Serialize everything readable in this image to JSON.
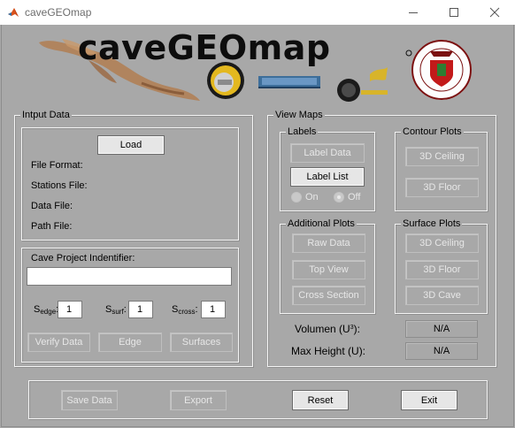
{
  "window": {
    "title": "caveGEOmap",
    "icon": "matlab-icon",
    "controls": [
      "minimize-icon",
      "maximize-icon",
      "close-icon"
    ]
  },
  "banner": {
    "title": "caveGEOmap",
    "logos": [
      "cave-survey-illustration",
      "round-badge-logo",
      "ucon-logo",
      "satellite-emblem-logo",
      "university-crest-seal"
    ]
  },
  "input_panel": {
    "title": "Intput Data",
    "load_label": "Load",
    "info": {
      "file_format": "File Format:",
      "stations_file": "Stations File:",
      "data_file": "Data File:",
      "path_file": "Path File:"
    },
    "project": {
      "label": "Cave Project Indentifier:",
      "value": "",
      "edge_label": "S",
      "edge_sub": "edge",
      "edge_value": "1",
      "surf_label": "S",
      "surf_sub": "surf",
      "surf_value": "1",
      "cross_label": "S",
      "cross_sub": "cross",
      "cross_value": "1",
      "verify_label": "Verify Data",
      "edge_btn_label": "Edge",
      "surfaces_label": "Surfaces"
    }
  },
  "view_panel": {
    "title": "View Maps",
    "labels": {
      "title": "Labels",
      "label_data": "Label Data",
      "label_list": "Label List",
      "on": "On",
      "off": "Off",
      "selected": "Off"
    },
    "contour": {
      "title": "Contour Plots",
      "ceiling": "3D Ceiling",
      "floor": "3D Floor"
    },
    "additional": {
      "title": "Additional Plots",
      "raw_data": "Raw Data",
      "top_view": "Top View",
      "cross_section": "Cross Section"
    },
    "surface": {
      "title": "Surface Plots",
      "ceiling": "3D Ceiling",
      "floor": "3D Floor",
      "cave": "3D Cave"
    },
    "volume_label": "Volumen (U",
    "volume_sup": "3",
    "volume_suffix": "):",
    "volume_value": "N/A",
    "max_height_label": "Max Height (U):",
    "max_height_value": "N/A"
  },
  "bottom": {
    "save_data": "Save Data",
    "export": "Export",
    "reset": "Reset",
    "exit": "Exit"
  },
  "colors": {
    "background": "#a8a8a8",
    "disabled_text": "#e7e7e7"
  }
}
